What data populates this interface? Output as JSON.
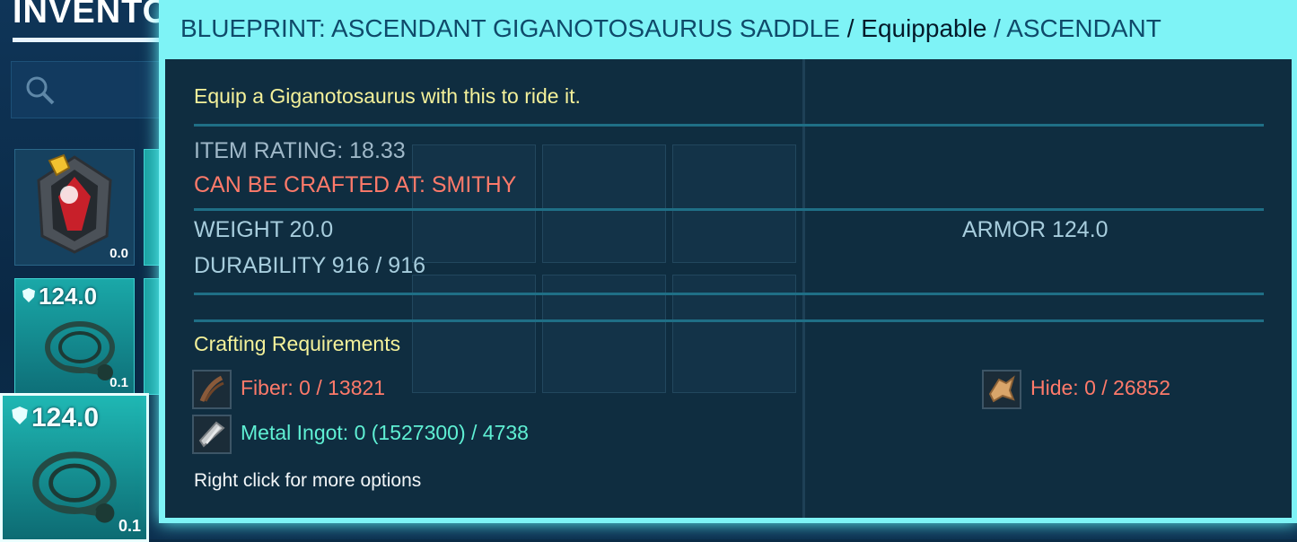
{
  "inventory": {
    "title": "INVENTO",
    "slots": [
      {
        "armor": "",
        "weight": "0.0"
      },
      {
        "armor": "124.0",
        "weight": "0.1"
      },
      {
        "armor": "124.0",
        "weight": "0.1"
      }
    ]
  },
  "tooltip": {
    "header": {
      "item_type": "BLUEPRINT: ASCENDANT GIGANOTOSAURUS SADDLE",
      "sep1": " / ",
      "category": "Equippable",
      "sep2": " / ",
      "quality": "ASCENDANT"
    },
    "description": "Equip a Giganotosaurus with this to ride it.",
    "item_rating": "ITEM RATING: 18.33",
    "crafted_at": "CAN BE CRAFTED AT: SMITHY",
    "weight": "WEIGHT 20.0",
    "durability": "DURABILITY 916 / 916",
    "armor": "ARMOR 124.0",
    "requirements_title": "Crafting Requirements",
    "requirements": [
      {
        "label": "Fiber: 0 / 13821",
        "icon": "fiber-icon",
        "color": "#ff7a6a"
      },
      {
        "label": "Hide: 0 / 26852",
        "icon": "hide-icon",
        "color": "#ff7a6a"
      },
      {
        "label": "Metal Ingot: 0 (1527300) / 4738",
        "icon": "metal-ingot-icon",
        "color": "#5ff0d4"
      }
    ],
    "hint": "Right click for more options"
  },
  "colors": {
    "tooltip_frame": "#7ef3f6",
    "tooltip_body": "#092034",
    "description": "#f4f19a",
    "warning": "#ff7a6a",
    "available": "#5ff0d4"
  }
}
